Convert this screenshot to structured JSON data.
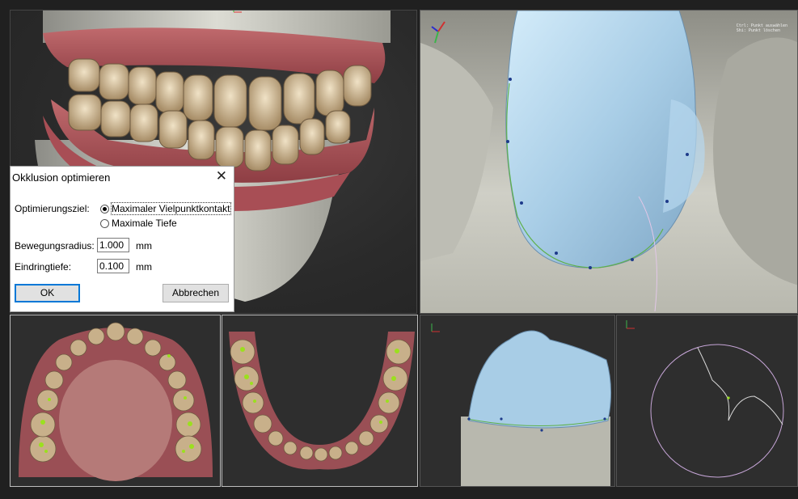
{
  "viewports": {
    "right_top_hud": [
      "Ctrl: Punkt auswählen",
      "Shi: Punkt löschen"
    ]
  },
  "dialog": {
    "title": "Okklusion optimieren",
    "close_glyph": "✕",
    "goal_label": "Optimierungsziel:",
    "goal_options": [
      "Maximaler Vielpunktkontakt",
      "Maximale Tiefe"
    ],
    "goal_selected": "Maximaler Vielpunktkontakt",
    "radius_label": "Bewegungsradius:",
    "radius_value": "1.000",
    "radius_unit": "mm",
    "depth_label": "Eindringtiefe:",
    "depth_value": "0.100",
    "depth_unit": "mm",
    "ok_label": "OK",
    "cancel_label": "Abbrechen"
  },
  "colors": {
    "background": "#202020",
    "crown_blue": "#a8cde6",
    "stone": "#c8c8c0",
    "gum": "#b85a5f",
    "tooth": "#d9c7a6",
    "contact": "#9be01e",
    "dialog_bg": "#ffffff",
    "button_focus": "#0078d7"
  }
}
